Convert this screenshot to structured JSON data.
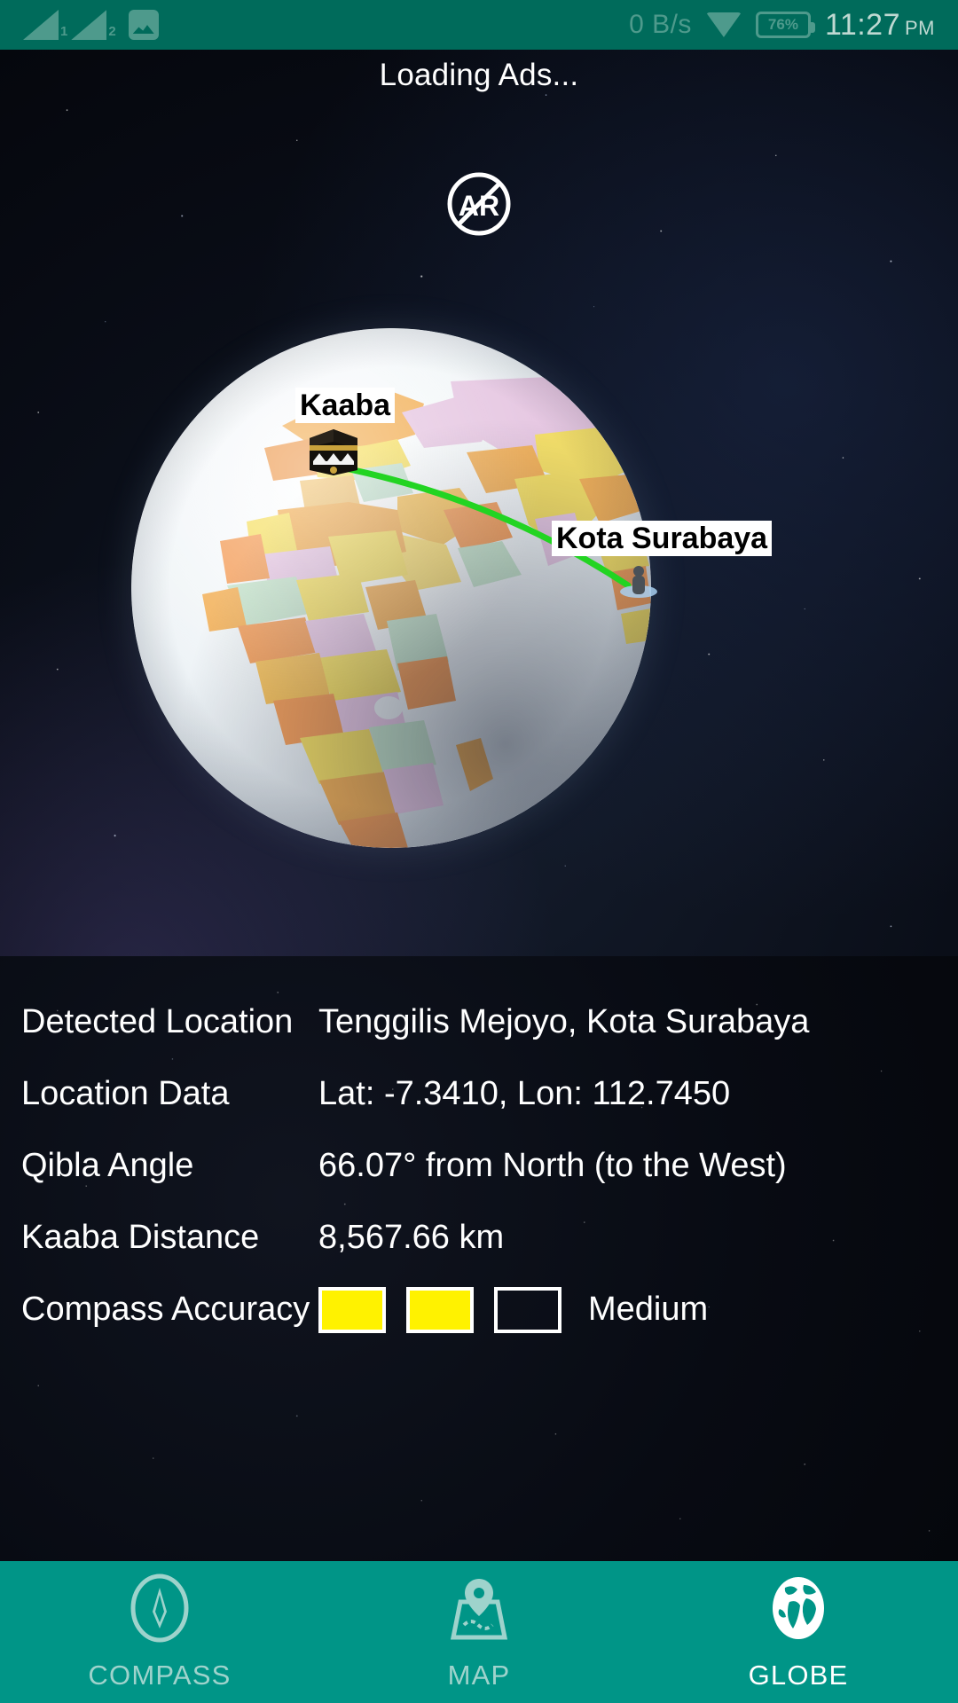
{
  "status_bar": {
    "sim1_label": "1",
    "sim2_label": "2",
    "network_speed": "0 B/s",
    "battery_percent": "76%",
    "time": "11:27",
    "time_period": "PM",
    "icons": [
      "signal-bars-sim1-icon",
      "signal-bars-sim2-icon",
      "photo-icon",
      "wifi-icon",
      "battery-icon"
    ]
  },
  "ad_banner": {
    "text": "Loading Ads..."
  },
  "ar_toggle": {
    "label": "AR",
    "state": "disabled",
    "icon": "ar-disabled-icon"
  },
  "globe": {
    "kaaba_label": "Kaaba",
    "user_label": "Kota Surabaya",
    "arc_color": "#22D422",
    "ocean_color": "#E9EEF2",
    "kaaba_marker_icon": "kaaba-cube-icon",
    "user_marker_icon": "person-pin-icon"
  },
  "fab": {
    "label": "+",
    "icon": "plus-icon",
    "color": "#E03A25"
  },
  "info_panel": {
    "rows": [
      {
        "label": "Detected Location",
        "value": "Tenggilis Mejoyo, Kota Surabaya"
      },
      {
        "label": "Location Data",
        "value": "Lat: -7.3410, Lon: 112.7450"
      },
      {
        "label": "Qibla Angle",
        "value": "66.07° from North (to the West)"
      },
      {
        "label": "Kaaba Distance",
        "value": "8,567.66 km"
      }
    ],
    "compass_accuracy": {
      "label": "Compass Accuracy",
      "value_text": "Medium",
      "filled_count": 2,
      "total_count": 3,
      "fill_color": "#FFF200"
    }
  },
  "bottom_nav": {
    "items": [
      {
        "label": "COMPASS",
        "icon": "compass-icon",
        "active": false
      },
      {
        "label": "MAP",
        "icon": "map-pin-icon",
        "active": false
      },
      {
        "label": "GLOBE",
        "icon": "globe-icon",
        "active": true
      }
    ]
  },
  "theme": {
    "status_bar_color": "#006B5B",
    "nav_bar_color": "#009587",
    "accent_color": "#E03A25",
    "active_nav_color": "#FFFFFF",
    "inactive_nav_color": "#9ED3CC"
  }
}
